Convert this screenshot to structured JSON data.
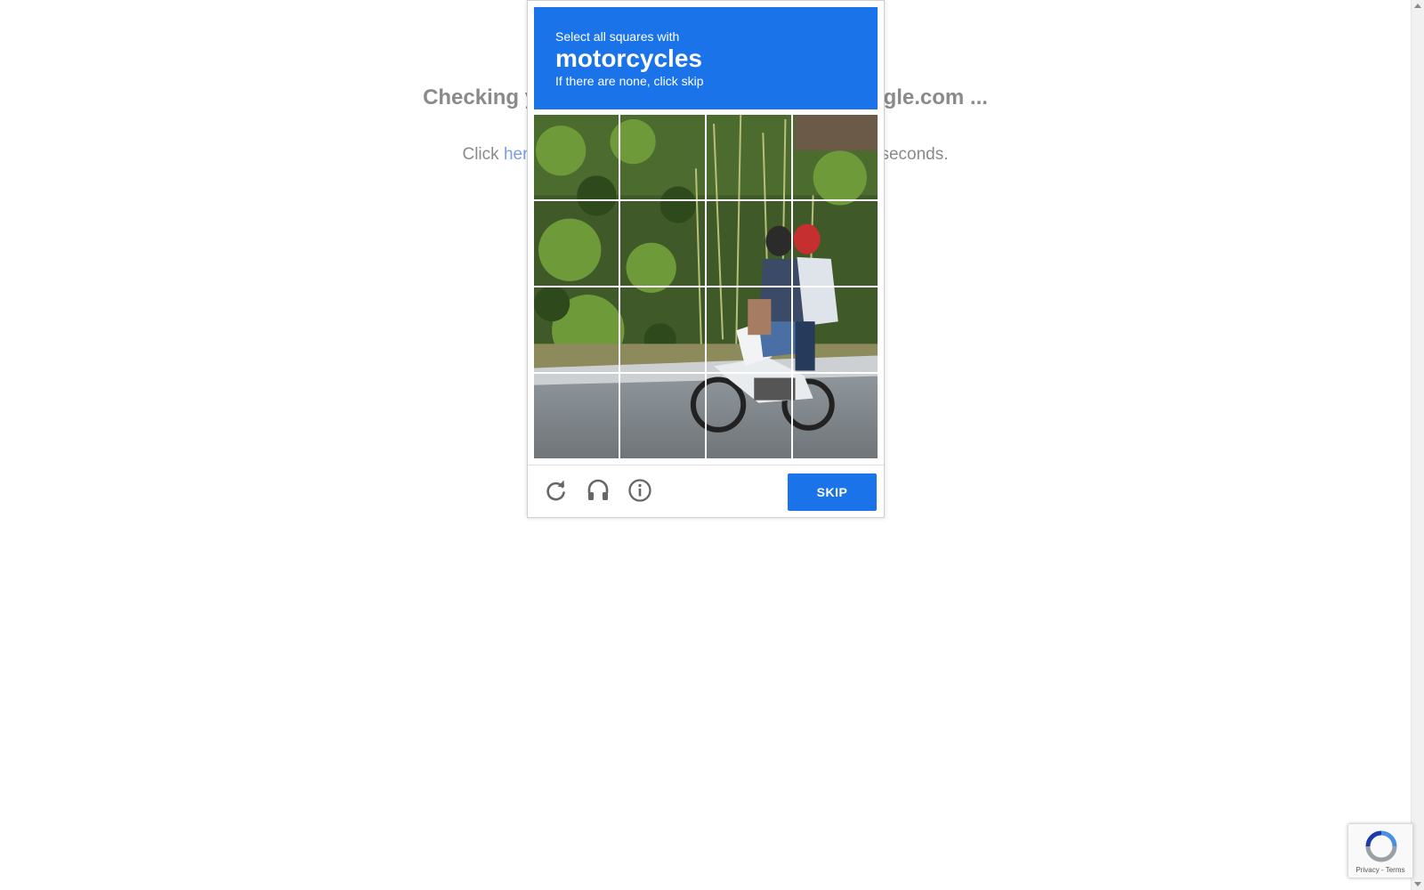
{
  "background": {
    "heading": "Checking your browser before accessing kaggle.com ...",
    "text_before": "Click ",
    "link": "here",
    "text_after": " if you are not automatically redirected after 5 seconds."
  },
  "challenge": {
    "instruction": "Select all squares with",
    "keyword": "motorcycles",
    "note": "If there are none, click skip",
    "skip_label": "SKIP",
    "tiles": [
      "1",
      "2",
      "3",
      "4",
      "5",
      "6",
      "7",
      "8",
      "9",
      "10",
      "11",
      "12",
      "13",
      "14",
      "15",
      "16"
    ],
    "icons": {
      "reload": "reload-icon",
      "audio": "headphones-icon",
      "info": "info-icon"
    },
    "accent_color": "#1a73e8"
  },
  "badge": {
    "links": "Privacy - Terms"
  }
}
